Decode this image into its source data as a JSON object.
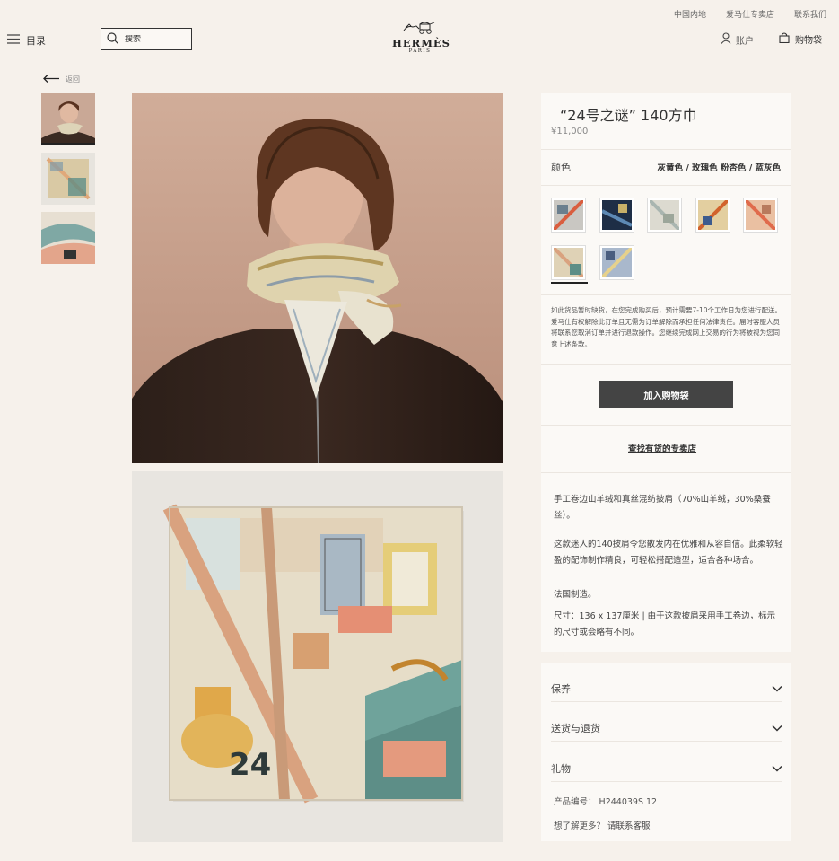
{
  "header": {
    "top_links": [
      "中国内地",
      "爱马仕专卖店",
      "联系我们"
    ],
    "menu_label": "目录",
    "search_placeholder": "搜索",
    "logo_word": "HERMÈS",
    "logo_sub": "PARIS",
    "account_label": "账户",
    "cart_label": "购物袋"
  },
  "nav": {
    "back_label": "返回"
  },
  "product": {
    "title": "“24号之谜” 140方巾",
    "price": "¥11,000",
    "color_label": "颜色",
    "color_value": "灰黄色 / 玫瑰色 粉杏色 / 蓝灰色",
    "swatch_count": 7,
    "selected_swatch": 6,
    "notice": "如此货品暂时缺货，在您完成购买后，预计需要7-10个工作日为您进行配送。爱马仕有权解除此订单且无需为订单解除而承担任何法律责任。届时客服人员将联系您取消订单并进行退款操作。您继续完成网上交易的行为将被视为您同意上述条款。",
    "add_to_bag": "加入购物袋",
    "find_store": "查找有货的专卖店",
    "description": [
      "手工卷边山羊绒和真丝混纺披肩（70%山羊绒，30%桑蚕丝）。",
      "这款迷人的140披肩令您散发内在优雅和从容自信。此柔软轻盈的配饰制作精良，可轻松搭配造型，适合各种场合。",
      "法国制造。",
      "尺寸：136 x 137厘米 | 由于这款披肩采用手工卷边，标示的尺寸或会略有不同。"
    ],
    "accordions": [
      "保养",
      "送货与退货",
      "礼物"
    ],
    "product_code_label": "产品编号：",
    "product_code": "H244039S 12",
    "more_question": "想了解更多？",
    "contact_link": "请联系客服"
  },
  "colors": {
    "background": "#f6f1eb",
    "panel": "#fbf9f6",
    "button": "#444444"
  }
}
